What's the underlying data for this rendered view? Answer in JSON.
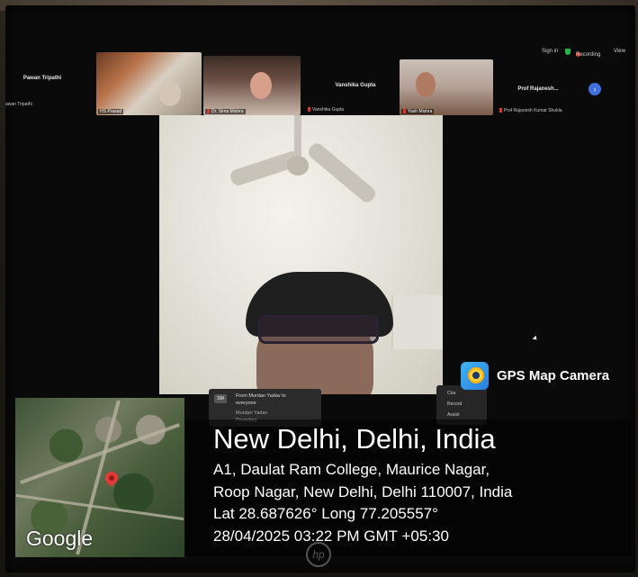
{
  "top_bar": {
    "sign_in": "Sign in",
    "recording": "Recording",
    "view": "View"
  },
  "participants": [
    {
      "name_large": "Pawan Tripathi",
      "name_small": "awan Tripathi"
    },
    {
      "name_small": "HS Prasad"
    },
    {
      "name_small": "Dr. Sima Mishra"
    },
    {
      "name_large": "Vanshika Gupta",
      "name_small": "Vanshika Gupta"
    },
    {
      "name_small": "Yash Mishra"
    },
    {
      "name_large": "Prof Rajanesh...",
      "name_small": "Prof Rajanesh Kumar Shukla"
    }
  ],
  "chat": {
    "line1": "From Murdan Yadav to",
    "line2": "everyone",
    "line3": "Murdan Yadav",
    "line4": "Poundary"
  },
  "menu": {
    "item1": "Cha",
    "item2": "Record",
    "item3": "Assist"
  },
  "gps": {
    "app_name": "GPS Map Camera",
    "map_brand": "Google",
    "city": "New Delhi, Delhi, India",
    "address_line1": "A1, Daulat Ram College, Maurice Nagar,",
    "address_line2": "Roop Nagar, New Delhi, Delhi 110007, India",
    "coords": "Lat 28.687626° Long 77.205557°",
    "timestamp": "28/04/2025 03:22 PM GMT +05:30"
  },
  "brand": "hp",
  "colors": {
    "recording": "#e0342c",
    "accent": "#3f6fe0",
    "map_pin": "#e53935"
  }
}
